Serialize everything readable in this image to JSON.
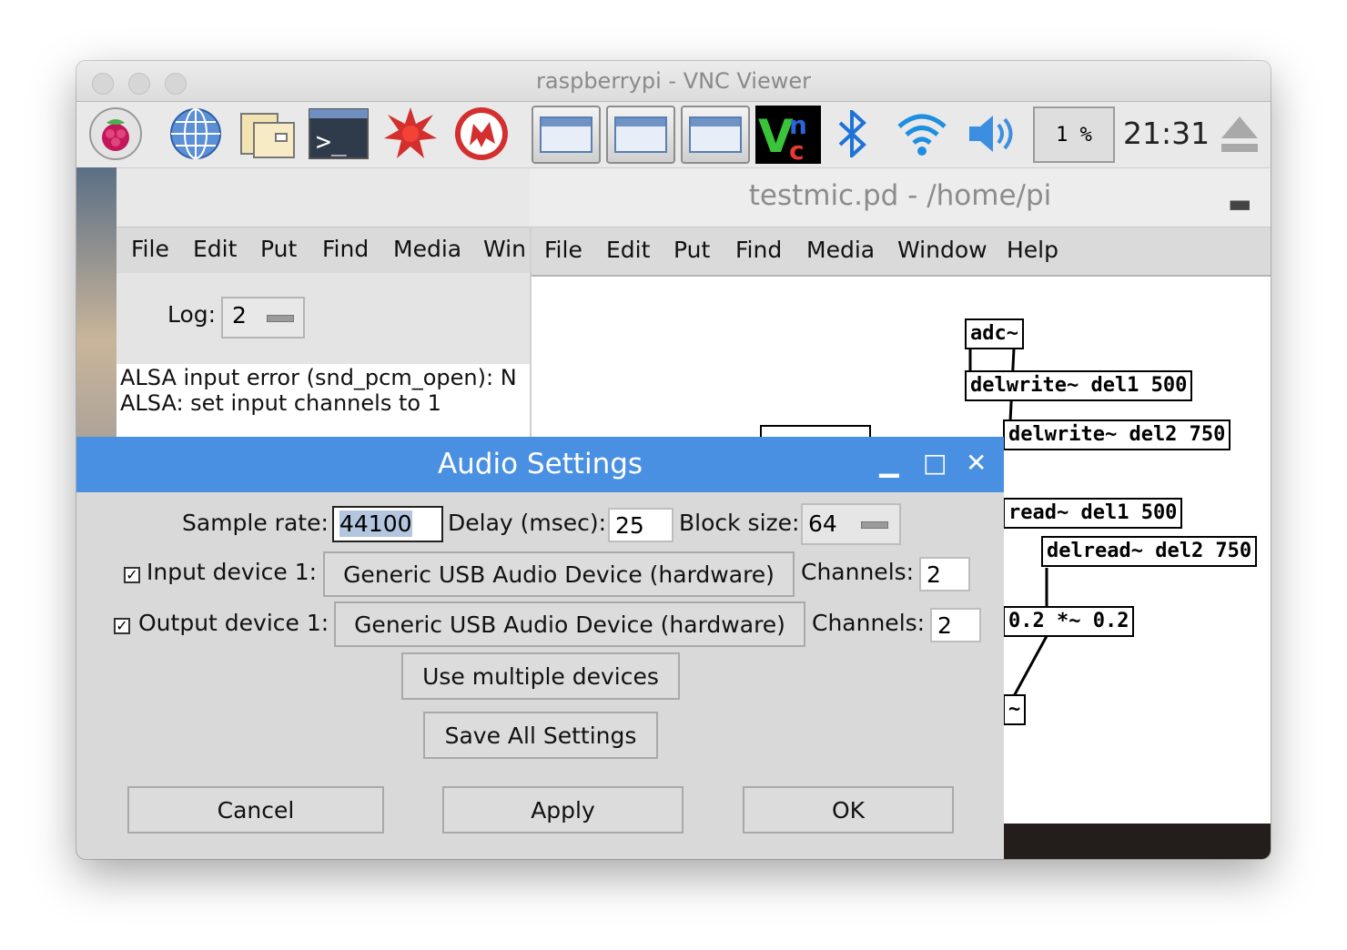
{
  "window": {
    "title": "raspberrypi - VNC Viewer"
  },
  "taskbar": {
    "icons": [
      "raspberry-menu-icon",
      "web-browser-icon",
      "file-manager-icon",
      "terminal-icon",
      "wolfram-icon",
      "mathematica-icon"
    ],
    "cpu_value": "1 %",
    "clock": "21:31"
  },
  "pd_main": {
    "menu": [
      "File",
      "Edit",
      "Put",
      "Find",
      "Media",
      "Win"
    ],
    "log_label": "Log:",
    "log_value": "2",
    "console": [
      "ALSA input error (snd_pcm_open): N",
      "ALSA: set input channels to 1"
    ]
  },
  "patch": {
    "title": "testmic.pd  - /home/pi",
    "menu": [
      "File",
      "Edit",
      "Put",
      "Find",
      "Media",
      "Window",
      "Help"
    ],
    "objects": [
      "adc~",
      "delwrite~ del1 500",
      "delwrite~ del2 750",
      "read~ del1 500",
      "delread~ del2 750",
      "0.2 *~ 0.2",
      "~"
    ]
  },
  "dialog": {
    "title": "Audio Settings",
    "sample_rate_label": "Sample rate:",
    "sample_rate_value": "44100",
    "delay_label": "Delay (msec):",
    "delay_value": "25",
    "block_label": "Block size:",
    "block_value": "64",
    "input_label": "Input device 1:",
    "input_device": "Generic USB Audio Device (hardware)",
    "input_channels_label": "Channels:",
    "input_channels": "2",
    "output_label": "Output device 1:",
    "output_device": "Generic USB Audio Device (hardware)",
    "output_channels_label": "Channels:",
    "output_channels": "2",
    "multi_button": "Use multiple devices",
    "save_button": "Save All Settings",
    "cancel_button": "Cancel",
    "apply_button": "Apply",
    "ok_button": "OK"
  }
}
